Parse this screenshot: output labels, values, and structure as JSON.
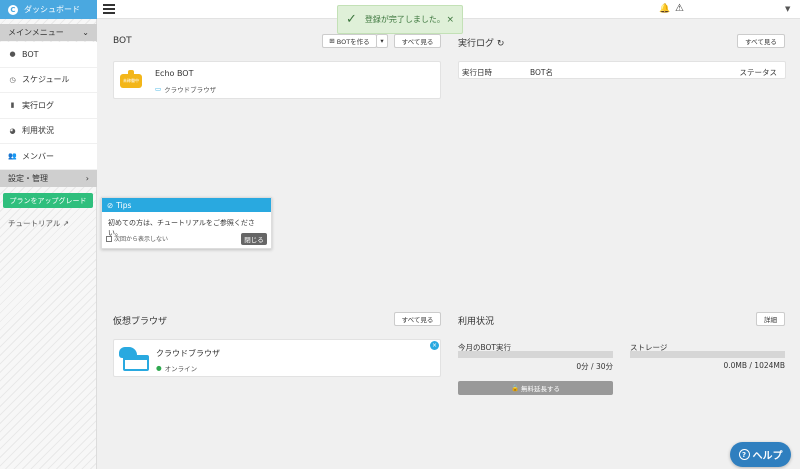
{
  "sidebar": {
    "dashboard": "ダッシュボード",
    "main_menu": "メインメニュー",
    "items": [
      {
        "label": "BOT",
        "icon": "robot-icon"
      },
      {
        "label": "スケジュール",
        "icon": "clock-icon"
      },
      {
        "label": "実行ログ",
        "icon": "file-icon"
      },
      {
        "label": "利用状況",
        "icon": "pie-chart-icon"
      },
      {
        "label": "メンバー",
        "icon": "users-icon"
      }
    ],
    "settings": "設定・管理",
    "upgrade": "プランをアップグレード",
    "tutorial": "チュートリアル"
  },
  "toast": {
    "message": "登録が完了しました。"
  },
  "bot": {
    "title": "BOT",
    "create": "BOTを作る",
    "view_all": "すべて見る",
    "card_name": "Echo BOT",
    "card_browser": "クラウドブラウザ",
    "avatar_label": "未稼働中"
  },
  "log": {
    "title": "実行ログ",
    "view_all": "すべて見る",
    "columns": [
      "実行日時",
      "BOT名",
      "ステータス"
    ]
  },
  "tips": {
    "title": "Tips",
    "body": "初めての方は、チュートリアルをご参照ください。",
    "dont_show": "次回から表示しない",
    "close": "閉じる"
  },
  "vbrowser": {
    "title": "仮想ブラウザ",
    "view_all": "すべて見る",
    "name": "クラウドブラウザ",
    "status": "オンライン"
  },
  "usage": {
    "title": "利用状況",
    "detail": "詳細",
    "monthly_label": "今月のBOT実行",
    "monthly_value": "0分 / 30分",
    "storage_label": "ストレージ",
    "storage_value": "0.0MB / 1024MB",
    "extend": "無料延長する"
  },
  "help": "ヘルプ",
  "colors": {
    "accent": "#4aa8e0",
    "success": "#2fbf7d",
    "toast_bg": "#dff0d8"
  }
}
